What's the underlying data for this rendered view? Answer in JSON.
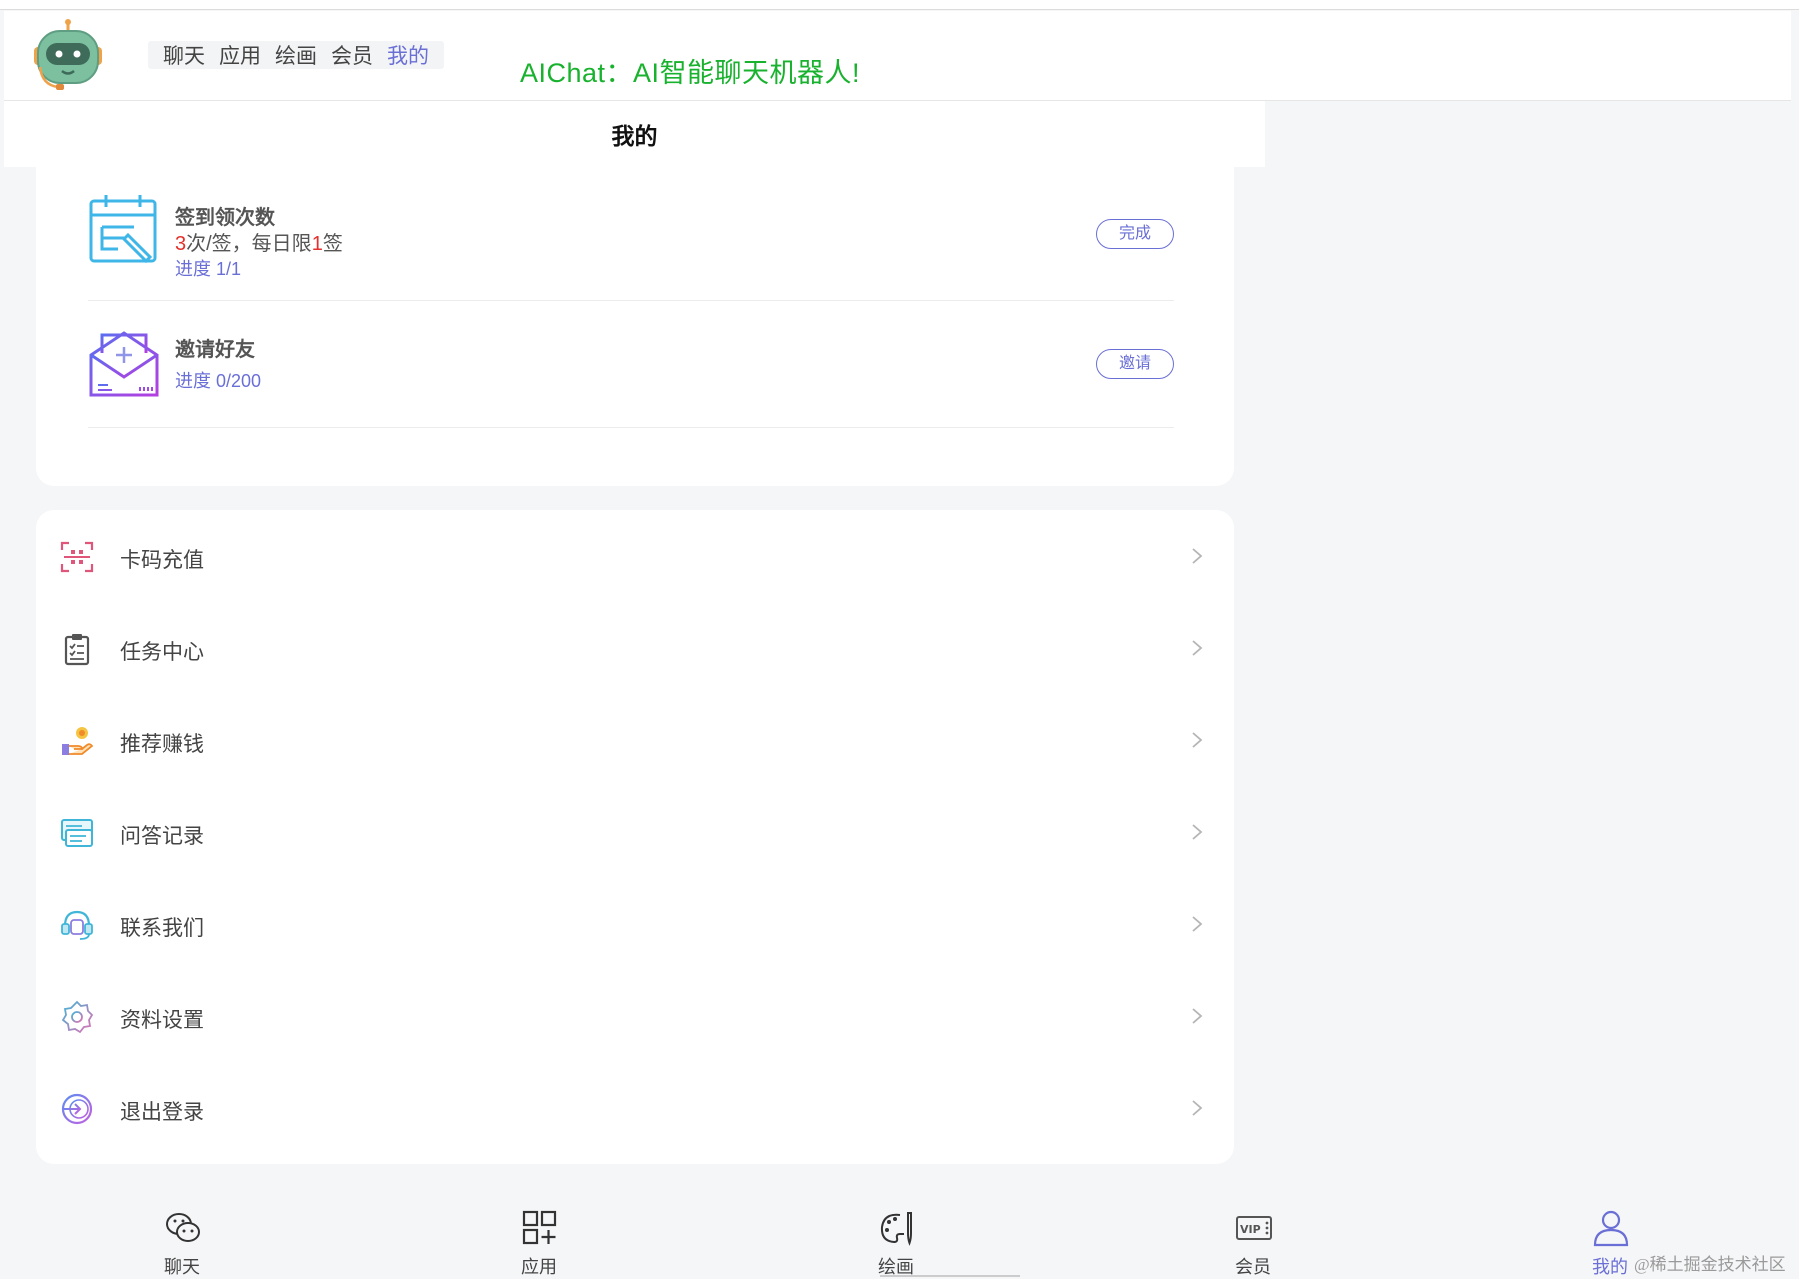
{
  "header": {
    "nav": [
      "聊天",
      "应用",
      "绘画",
      "会员",
      "我的"
    ],
    "active_nav_index": 4,
    "slogan": "AIChat：AI智能聊天机器人!"
  },
  "page": {
    "title": "我的"
  },
  "tasks": [
    {
      "title": "签到领次数",
      "desc_count": "3",
      "desc_mid": "次/签，每日限",
      "desc_limit": "1",
      "desc_end": "签",
      "progress": "进度 1/1",
      "button": "完成",
      "icon": "calendar-sign-icon"
    },
    {
      "title": "邀请好友",
      "progress": "进度 0/200",
      "button": "邀请",
      "icon": "invite-envelope-icon"
    }
  ],
  "menu": [
    {
      "label": "卡码充值",
      "icon": "scan-code-icon"
    },
    {
      "label": "任务中心",
      "icon": "clipboard-icon"
    },
    {
      "label": "推荐赚钱",
      "icon": "hand-coin-icon"
    },
    {
      "label": "问答记录",
      "icon": "records-icon"
    },
    {
      "label": "联系我们",
      "icon": "headset-icon"
    },
    {
      "label": "资料设置",
      "icon": "gear-icon"
    },
    {
      "label": "退出登录",
      "icon": "logout-icon"
    }
  ],
  "tabbar": [
    {
      "label": "聊天",
      "icon": "wechat-chat-icon"
    },
    {
      "label": "应用",
      "icon": "apps-grid-icon"
    },
    {
      "label": "绘画",
      "icon": "palette-icon"
    },
    {
      "label": "会员",
      "icon": "vip-card-icon"
    },
    {
      "label": "我的",
      "icon": "user-icon"
    }
  ],
  "active_tab_index": 4,
  "watermark": "@稀土掘金技术社区",
  "colors": {
    "accent": "#6a6fd6",
    "slogan_green": "#19b22e",
    "highlight_red": "#e4312b",
    "background": "#f5f6f8"
  }
}
